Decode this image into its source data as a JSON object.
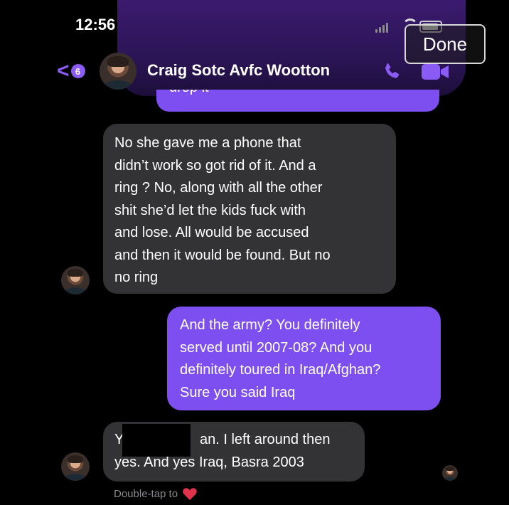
{
  "status_bar": {
    "time": "12:56"
  },
  "header": {
    "back_count": "6",
    "back_chevron": "<",
    "contact_name": "Craig Sotc Avfc Wootton",
    "done_label": "Done",
    "icons": [
      "back-chevron-icon",
      "phone-icon",
      "video-camera-icon"
    ]
  },
  "messages": [
    {
      "direction": "outgoing",
      "text": "drop it"
    },
    {
      "direction": "incoming",
      "lines": [
        "No she gave me a phone that",
        "didn’t work so got rid of it. And a",
        "ring ? No, along with all the other",
        "shit she’d let the kids fuck with",
        "and lose. All would be accused",
        "and then it would be found. But no",
        "no ring"
      ]
    },
    {
      "direction": "outgoing",
      "lines": [
        "And the army? You definitely",
        "served until 2007-08? And you",
        "definitely toured in Iraq/Afghan?",
        "Sure you said Iraq"
      ]
    },
    {
      "direction": "incoming",
      "lines": [
        "Y",
        "an. I left around then",
        "yes. And yes Iraq, Basra 2003"
      ]
    }
  ],
  "reaction_hint": "Double-tap to",
  "colors": {
    "outgoing_bubble": "#7e4ff0",
    "incoming_bubble": "#333336",
    "accent": "#8a5cf5",
    "heart": "#e0324b"
  }
}
